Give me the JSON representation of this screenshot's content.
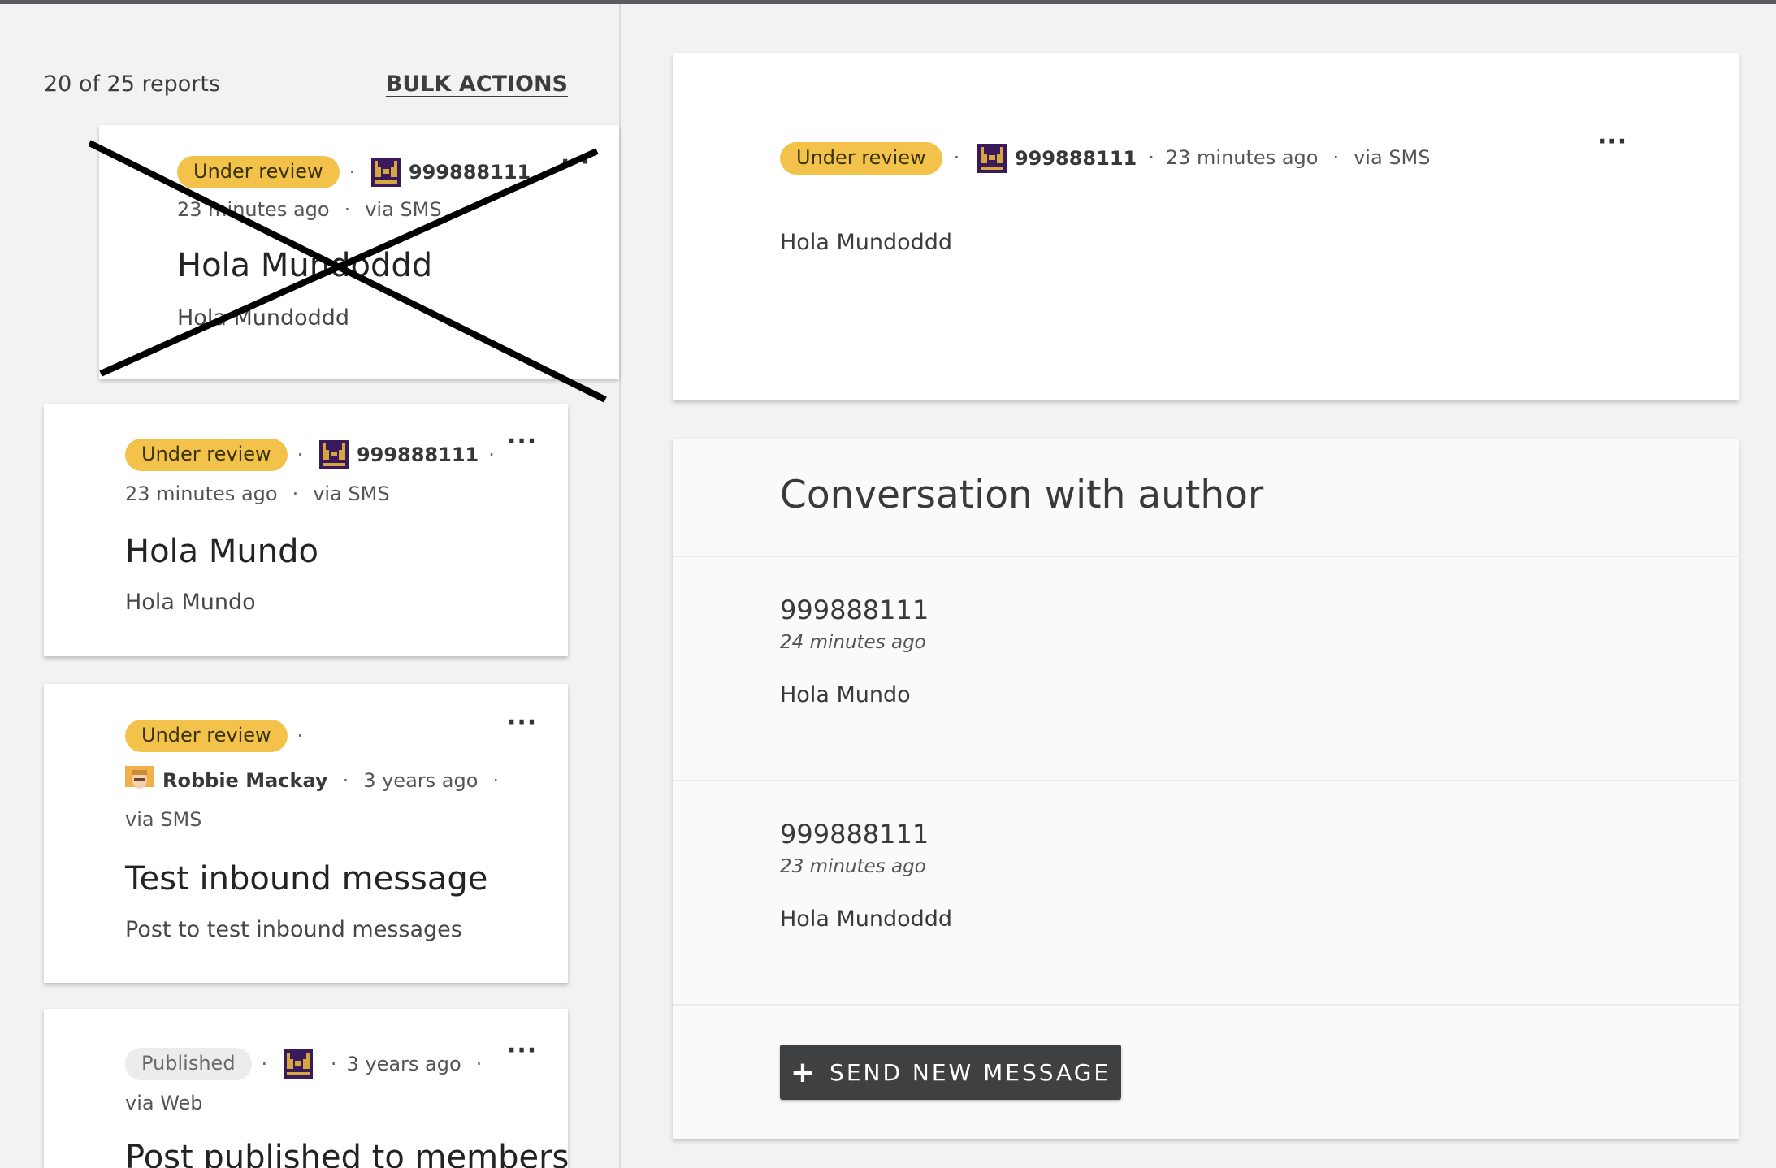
{
  "list": {
    "count_label": "20 of 25 reports",
    "bulk_actions": "BULK ACTIONS",
    "cards": [
      {
        "status": "Under review",
        "author": "999888111",
        "time": "23 minutes ago",
        "source": "via SMS",
        "title": "Hola Mundoddd",
        "body": "Hola Mundoddd",
        "avatar": "pixel-avatar-icon",
        "crossed_out": true
      },
      {
        "status": "Under review",
        "author": "999888111",
        "time": "23 minutes ago",
        "source": "via SMS",
        "title": "Hola Mundo",
        "body": "Hola Mundo",
        "avatar": "pixel-avatar-icon"
      },
      {
        "status": "Under review",
        "author": "Robbie Mackay",
        "time": "3 years ago",
        "source": "via SMS",
        "title": "Test inbound message",
        "body": "Post to test inbound messages",
        "avatar": "user-photo-avatar"
      },
      {
        "status": "Published",
        "time": "3 years ago",
        "source": "via Web",
        "title": "Post published to members",
        "avatar": "pixel-avatar-icon"
      }
    ]
  },
  "detail": {
    "status": "Under review",
    "author": "999888111",
    "time": "23 minutes ago",
    "source": "via SMS",
    "body": "Hola Mundoddd"
  },
  "conversation": {
    "title": "Conversation with author",
    "messages": [
      {
        "author": "999888111",
        "time": "24 minutes ago",
        "body": "Hola Mundo"
      },
      {
        "author": "999888111",
        "time": "23 minutes ago",
        "body": "Hola Mundoddd"
      }
    ],
    "send_button": "SEND NEW MESSAGE"
  },
  "colors": {
    "badge_review": "#f3c24a",
    "badge_published": "#ececec",
    "button_dark": "#3e4042",
    "avatar_purple": "#3b1a5c",
    "avatar_gold": "#d6a640"
  }
}
